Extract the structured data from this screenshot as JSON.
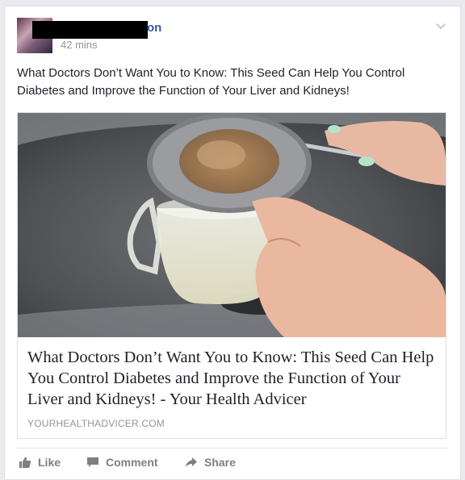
{
  "post": {
    "author_suffix": "on",
    "timestamp": "42 mins",
    "text": "What Doctors Don’t Want You to Know: This Seed Can Help You Control Diabetes and Improve the Function of Your Liver and Kidneys!"
  },
  "link_card": {
    "title": "What Doctors Don’t Want You to Know: This Seed Can Help You Control Diabetes and Improve the Function of Your Liver and Kidneys! - Your Health Advicer",
    "domain": "YOURHEALTHADVICER.COM"
  },
  "actions": {
    "like": "Like",
    "comment": "Comment",
    "share": "Share"
  },
  "colors": {
    "author_link": "#365899",
    "meta_gray": "#90949c",
    "action_gray": "#7f7f7f"
  },
  "icons": [
    "chevron-down-icon",
    "thumbs-up-icon",
    "comment-icon",
    "share-arrow-icon"
  ]
}
